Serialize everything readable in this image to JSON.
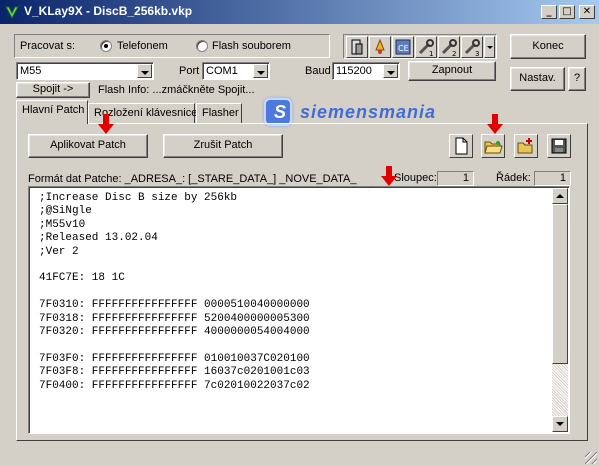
{
  "window": {
    "title": "V_KLay9X - DiscB_256kb.vkp"
  },
  "title_buttons": {
    "minimize": "_",
    "maximize": "□",
    "close": "✕"
  },
  "connection": {
    "label": "Pracovat s:",
    "radio_phone": "Telefonem",
    "radio_file": "Flash souborem",
    "selected": "Telefonem",
    "model_value": "M55",
    "port_label": "Port",
    "port_value": "COM1",
    "baud_label": "Baud",
    "baud_value": "115200",
    "connect_button": "Spojit ->",
    "flash_info": "Flash Info: ...zmáčkněte Spojit...",
    "toggle_button": "Zapnout"
  },
  "side_buttons": {
    "end": "Konec",
    "settings": "Nastav.",
    "help": "?"
  },
  "logo": {
    "text": "siemensmania"
  },
  "tabs": [
    {
      "label": "Hlavní Patch",
      "active": true
    },
    {
      "label": "Rozložení klávesnice",
      "active": false
    },
    {
      "label": "Flasher",
      "active": false
    }
  ],
  "patch": {
    "apply_button": "Aplikovat Patch",
    "cancel_button": "Zrušit Patch",
    "format_text": "Formát dat Patche: _ADRESA_: [_STARE_DATA_] _NOVE_DATA_",
    "column_label": "Sloupec:",
    "column_value": "1",
    "row_label": "Řádek:",
    "row_value": "1"
  },
  "editor_lines": [
    ";Increase Disc B size by 256kb",
    ";@SiNgle",
    ";M55v10",
    ";Released 13.02.04",
    ";Ver 2",
    "",
    "41FC7E: 18 1C",
    "",
    "7F0310: FFFFFFFFFFFFFFFF 0000510040000000",
    "7F0318: FFFFFFFFFFFFFFFF 5200400000005300",
    "7F0320: FFFFFFFFFFFFFFFF 4000000054004000",
    "",
    "7F03F0: FFFFFFFFFFFFFFFF 010010037C020100",
    "7F03F8: FFFFFFFFFFFFFFFF 16037c0201001c03",
    "7F0400: FFFFFFFFFFFFFFFF 7c02010022037c02"
  ],
  "colors": {
    "title_start": "#0a246a",
    "title_end": "#a6caf0",
    "face": "#d4d0c8",
    "annotation_arrow": "#e00000",
    "logo_blue": "#2a5bd7"
  },
  "toolbar_icons": [
    "phone-icon",
    "bell-icon",
    "ce-icon",
    "tools-1-icon",
    "tools-2-icon",
    "tools-3-icon"
  ],
  "file_icons": [
    "new-file-icon",
    "open-folder-icon",
    "add-icon",
    "save-icon"
  ]
}
